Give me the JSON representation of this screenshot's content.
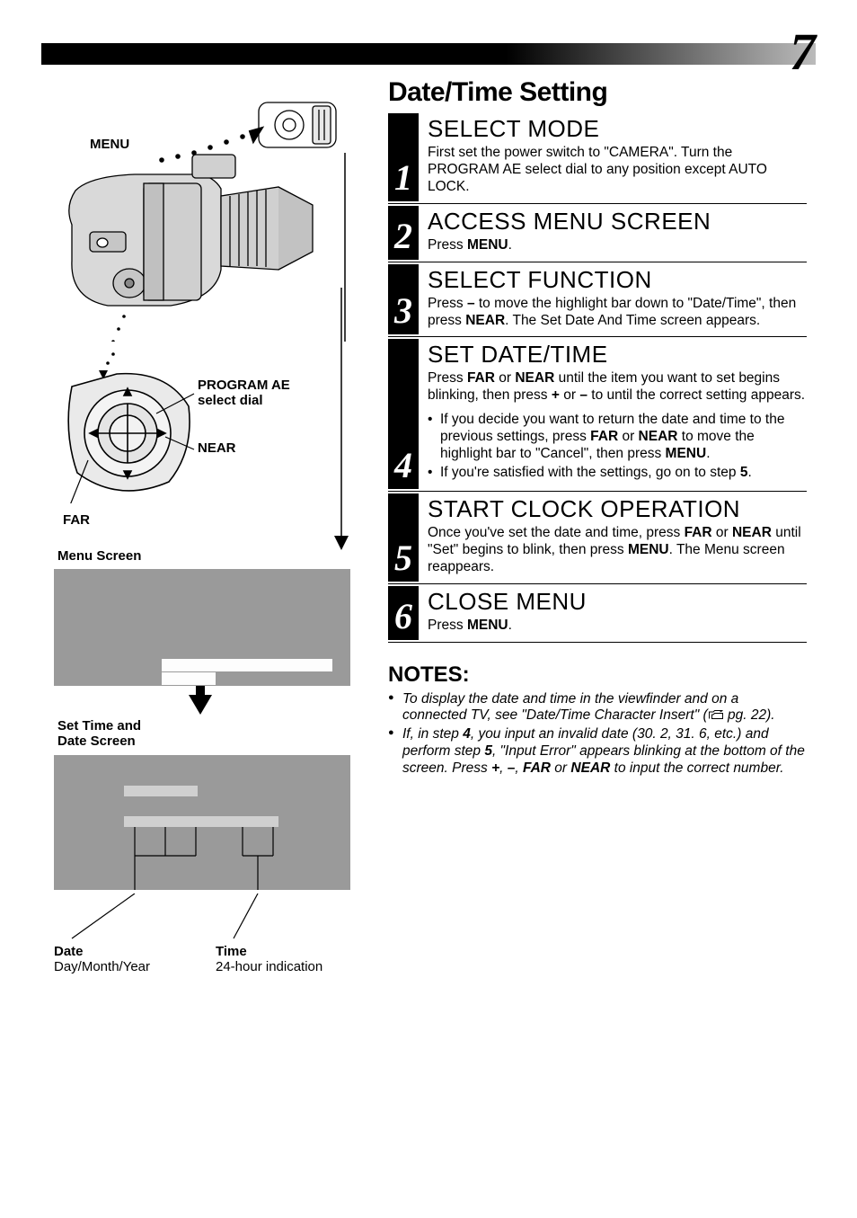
{
  "page_number": "7",
  "left": {
    "menu_label": "MENU",
    "program_ae_label": "PROGRAM AE\nselect dial",
    "near_label": "NEAR",
    "far_label": "FAR",
    "menu_screen_label": "Menu Screen",
    "set_screen_label": "Set Time and\nDate Screen",
    "date": {
      "heading": "Date",
      "sub": "Day/Month/Year"
    },
    "time": {
      "heading": "Time",
      "sub": "24-hour indication"
    }
  },
  "section_title": "Date/Time Setting",
  "steps": [
    {
      "num": "1",
      "title": "SELECT MODE",
      "html": "First set the power switch to \"CAMERA\". Turn the PROGRAM AE select dial to any position except AUTO LOCK."
    },
    {
      "num": "2",
      "title": "ACCESS MENU SCREEN",
      "html": "Press <b>MENU</b>."
    },
    {
      "num": "3",
      "title": "SELECT FUNCTION",
      "html": "Press <b>–</b> to move the highlight bar down to \"Date/Time\", then press <b>NEAR</b>. The Set Date And Time screen appears."
    },
    {
      "num": "4",
      "title": "SET DATE/TIME",
      "html": "Press <b>FAR</b> or <b>NEAR</b> until the item you want to set begins blinking, then press <b>+</b> or <b>–</b> to until the correct setting appears.",
      "bullets": [
        "If you decide you want to return the date and time to the previous settings, press <b>FAR</b> or <b>NEAR</b> to move the highlight bar to \"Cancel\", then press <b>MENU</b>.",
        "If you're satisfied with the settings, go on to step <b>5</b>."
      ]
    },
    {
      "num": "5",
      "title": "START CLOCK OPERATION",
      "html": "Once you've set the date and time, press <b>FAR</b> or <b>NEAR</b> until \"Set\" begins to blink, then press <b>MENU</b>. The Menu screen reappears."
    },
    {
      "num": "6",
      "title": "CLOSE MENU",
      "html": "Press <b>MENU</b>."
    }
  ],
  "notes_title": "NOTES:",
  "notes": [
    "To display the date and time in the viewfinder and on a connected TV, see \"Date/Time Character Insert\" (<svg class=\"ref-icon\" viewBox=\"0 0 24 16\"><path d=\"M2 14 L2 4 L8 4 L10 2 L22 2 M6 14 L22 14 L22 6 L10 6 L8 8 L6 8 Z M18 4 L22 2\" fill=\"none\" stroke=\"#000\" stroke-width=\"1.3\"/></svg> pg. 22).",
    "If, in step <b>4</b>, you input an invalid date (30. 2, 31. 6, etc.) and perform step <b>5</b>, \"Input Error\" appears blinking at the bottom of the screen. Press <b>+</b>, <b>–</b>, <b>FAR</b> or <b>NEAR</b> to input the correct number."
  ]
}
